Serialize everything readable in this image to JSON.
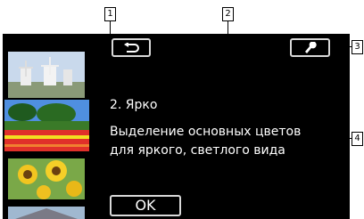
{
  "screen": {
    "effect_title": "2. Ярко",
    "description_lines": [
      "Выделение основных цветов",
      "для яркого, светлого вида"
    ],
    "ok_label": "OK"
  },
  "icons": {
    "back": "return-arrow-icon",
    "tool": "wrench-icon"
  },
  "thumbnails": [
    "windmills-landscape",
    "red-tulip-field",
    "sunflower-field",
    "building-roof"
  ],
  "callouts": [
    "1",
    "2",
    "3",
    "4"
  ],
  "colors": {
    "background": "#000000",
    "button_border": "#d9d9d9",
    "text": "#ffffff"
  }
}
